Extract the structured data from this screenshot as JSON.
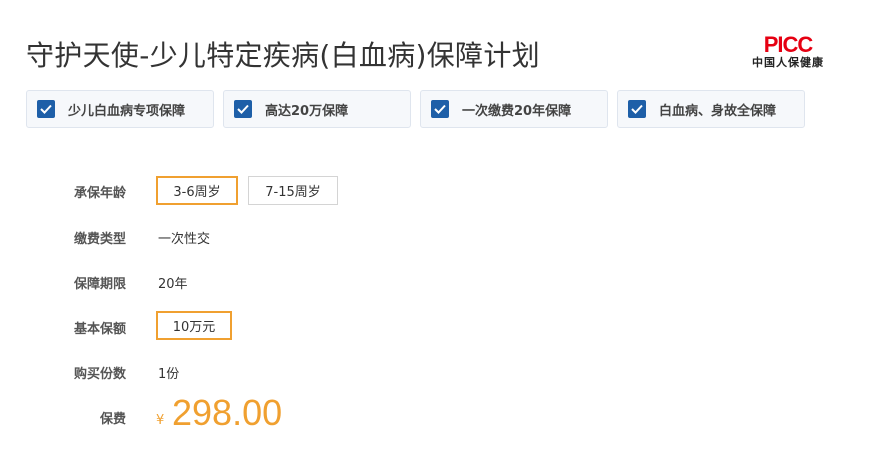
{
  "product": {
    "title": "守护天使-少儿特定疾病(白血病)保障计划",
    "logo_brand": "PICC",
    "logo_sub": "中国人保健康"
  },
  "features": [
    {
      "label": "少儿白血病专项保障",
      "checked": true
    },
    {
      "label": "高达20万保障",
      "checked": true
    },
    {
      "label": "一次缴费20年保障",
      "checked": true
    },
    {
      "label": "白血病、身故全保障",
      "checked": true
    }
  ],
  "form": {
    "age": {
      "label": "承保年龄",
      "options": [
        "3-6周岁",
        "7-15周岁"
      ],
      "selected": "3-6周岁"
    },
    "payment_type": {
      "label": "缴费类型",
      "value": "一次性交"
    },
    "coverage_period": {
      "label": "保障期限",
      "value": "20年"
    },
    "basic_coverage": {
      "label": "基本保额",
      "options": [
        "10万元"
      ],
      "selected": "10万元"
    },
    "quantity": {
      "label": "购买份数",
      "value": "1份"
    },
    "premium": {
      "label": "保费",
      "currency": "¥",
      "amount": "298.00"
    }
  },
  "colors": {
    "accent": "#f0a030",
    "check": "#1e5fa8",
    "brand": "#e60012"
  }
}
